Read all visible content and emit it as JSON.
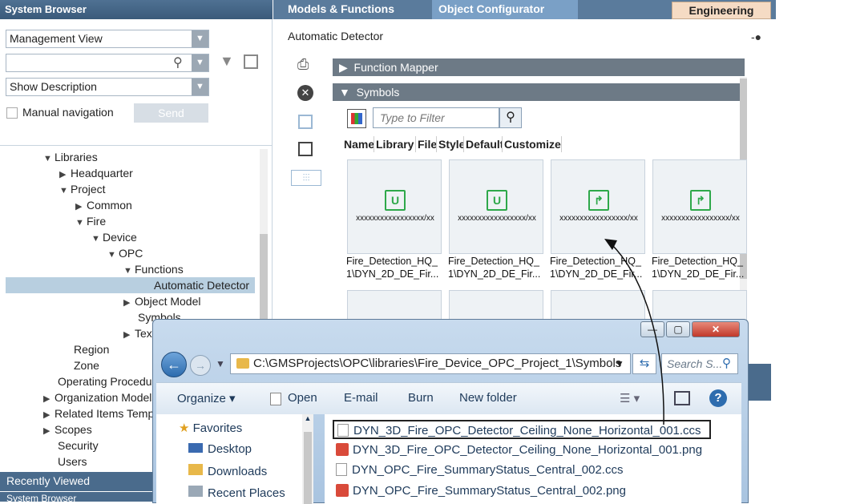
{
  "system_browser": {
    "title": "System Browser",
    "view_select": "Management View",
    "search_value": "",
    "desc_select": "Show Description",
    "manual_nav_label": "Manual navigation",
    "send_label": "Send",
    "tree": [
      "Libraries",
      "Headquarter",
      "Project",
      "Common",
      "Fire",
      "Device",
      "OPC",
      "Functions",
      "Automatic Detector",
      "Object Model",
      "Symbols",
      "Texts",
      "Region",
      "Zone",
      "Operating Procedures",
      "Organization Models",
      "Related Items Templates",
      "Scopes",
      "Security",
      "Users"
    ],
    "recently_viewed": "Recently Viewed",
    "system_browser_tab": "System Browser"
  },
  "main": {
    "tab_models": "Models & Functions",
    "tab_object": "Object Configurator",
    "engineering": "Engineering",
    "object_title": "Automatic Detector",
    "function_mapper": "Function Mapper",
    "symbols": "Symbols",
    "filter_placeholder": "Type to Filter",
    "columns": [
      "Name",
      "Library",
      "File",
      "Style",
      "Default",
      "Customize"
    ],
    "card_code": "xxxxxxxxxxxxxxxxx/xx",
    "card_name_1": "Fire_Detection_HQ_",
    "card_name_2": "1\\DYN_2D_DE_Fir..."
  },
  "explorer": {
    "path": "C:\\GMSProjects\\OPC\\libraries\\Fire_Device_OPC_Project_1\\Symbols",
    "search_placeholder": "Search S...",
    "organize": "Organize ▾",
    "open": "Open",
    "email": "E-mail",
    "burn": "Burn",
    "new_folder": "New folder",
    "nav_items": [
      "Favorites",
      "Desktop",
      "Downloads",
      "Recent Places"
    ],
    "files": [
      "DYN_3D_Fire_OPC_Detector_Ceiling_None_Horizontal_001.ccs",
      "DYN_3D_Fire_OPC_Detector_Ceiling_None_Horizontal_001.png",
      "DYN_OPC_Fire_SummaryStatus_Central_002.ccs",
      "DYN_OPC_Fire_SummaryStatus_Central_002.png"
    ]
  }
}
